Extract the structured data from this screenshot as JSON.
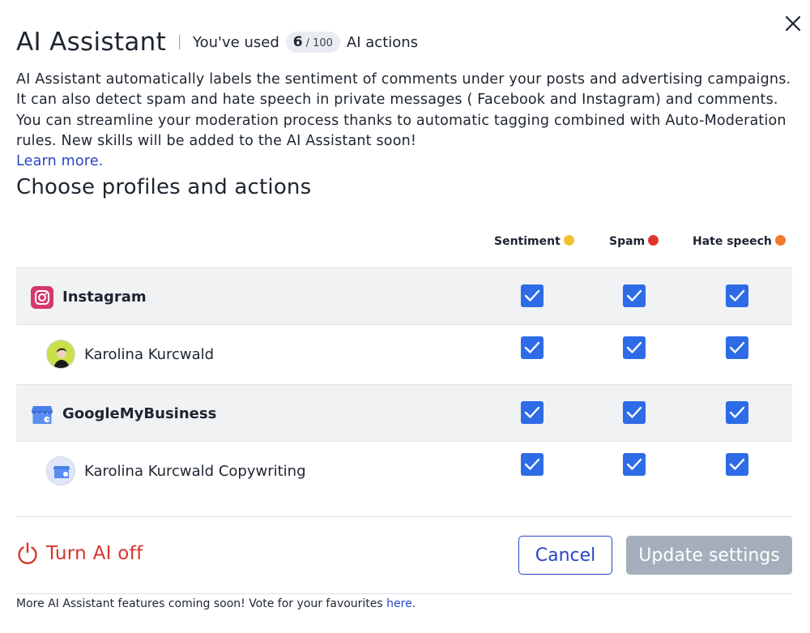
{
  "header": {
    "title": "AI Assistant",
    "usage_prefix": "You've used",
    "usage_used": "6",
    "usage_total": "/ 100",
    "usage_suffix": "AI actions"
  },
  "description": {
    "text": "AI Assistant automatically labels the sentiment of comments under your posts and advertising campaigns. It can also detect spam and hate speech in private messages ( Facebook and Instagram) and comments. You can streamline your moderation process thanks to automatic tagging combined with Auto-Moderation rules. New skills will be added to the AI Assistant soon!",
    "learn_more": "Learn more."
  },
  "section_title": "Choose profiles and actions",
  "columns": [
    {
      "label": "Sentiment",
      "icon": "neutral-face-emoji",
      "color": "#f2c230"
    },
    {
      "label": "Spam",
      "icon": "red-circle-emoji",
      "color": "#e0352c"
    },
    {
      "label": "Hate speech",
      "icon": "angry-face-emoji",
      "color": "#f07a2a"
    }
  ],
  "rows": [
    {
      "type": "profile",
      "label": "Instagram",
      "icon": "instagram-icon",
      "checked": [
        true,
        true,
        true
      ]
    },
    {
      "type": "account",
      "label": "Karolina Kurcwald",
      "icon": "avatar",
      "checked": [
        true,
        true,
        true
      ]
    },
    {
      "type": "profile",
      "label": "GoogleMyBusiness",
      "icon": "google-my-business-icon",
      "checked": [
        true,
        true,
        true
      ]
    },
    {
      "type": "account",
      "label": "Karolina Kurcwald Copywriting",
      "icon": "gmb-avatar",
      "checked": [
        true,
        true,
        true
      ]
    }
  ],
  "actions": {
    "turn_off": "Turn AI off",
    "cancel": "Cancel",
    "update": "Update settings"
  },
  "footer": {
    "text": "More AI Assistant features coming soon! Vote for your favourites",
    "link": "here",
    "period": "."
  },
  "colors": {
    "accent": "#2845c8",
    "checkbox": "#2e6be6",
    "danger": "#d8342c",
    "disabled_button": "#a4afbb"
  }
}
